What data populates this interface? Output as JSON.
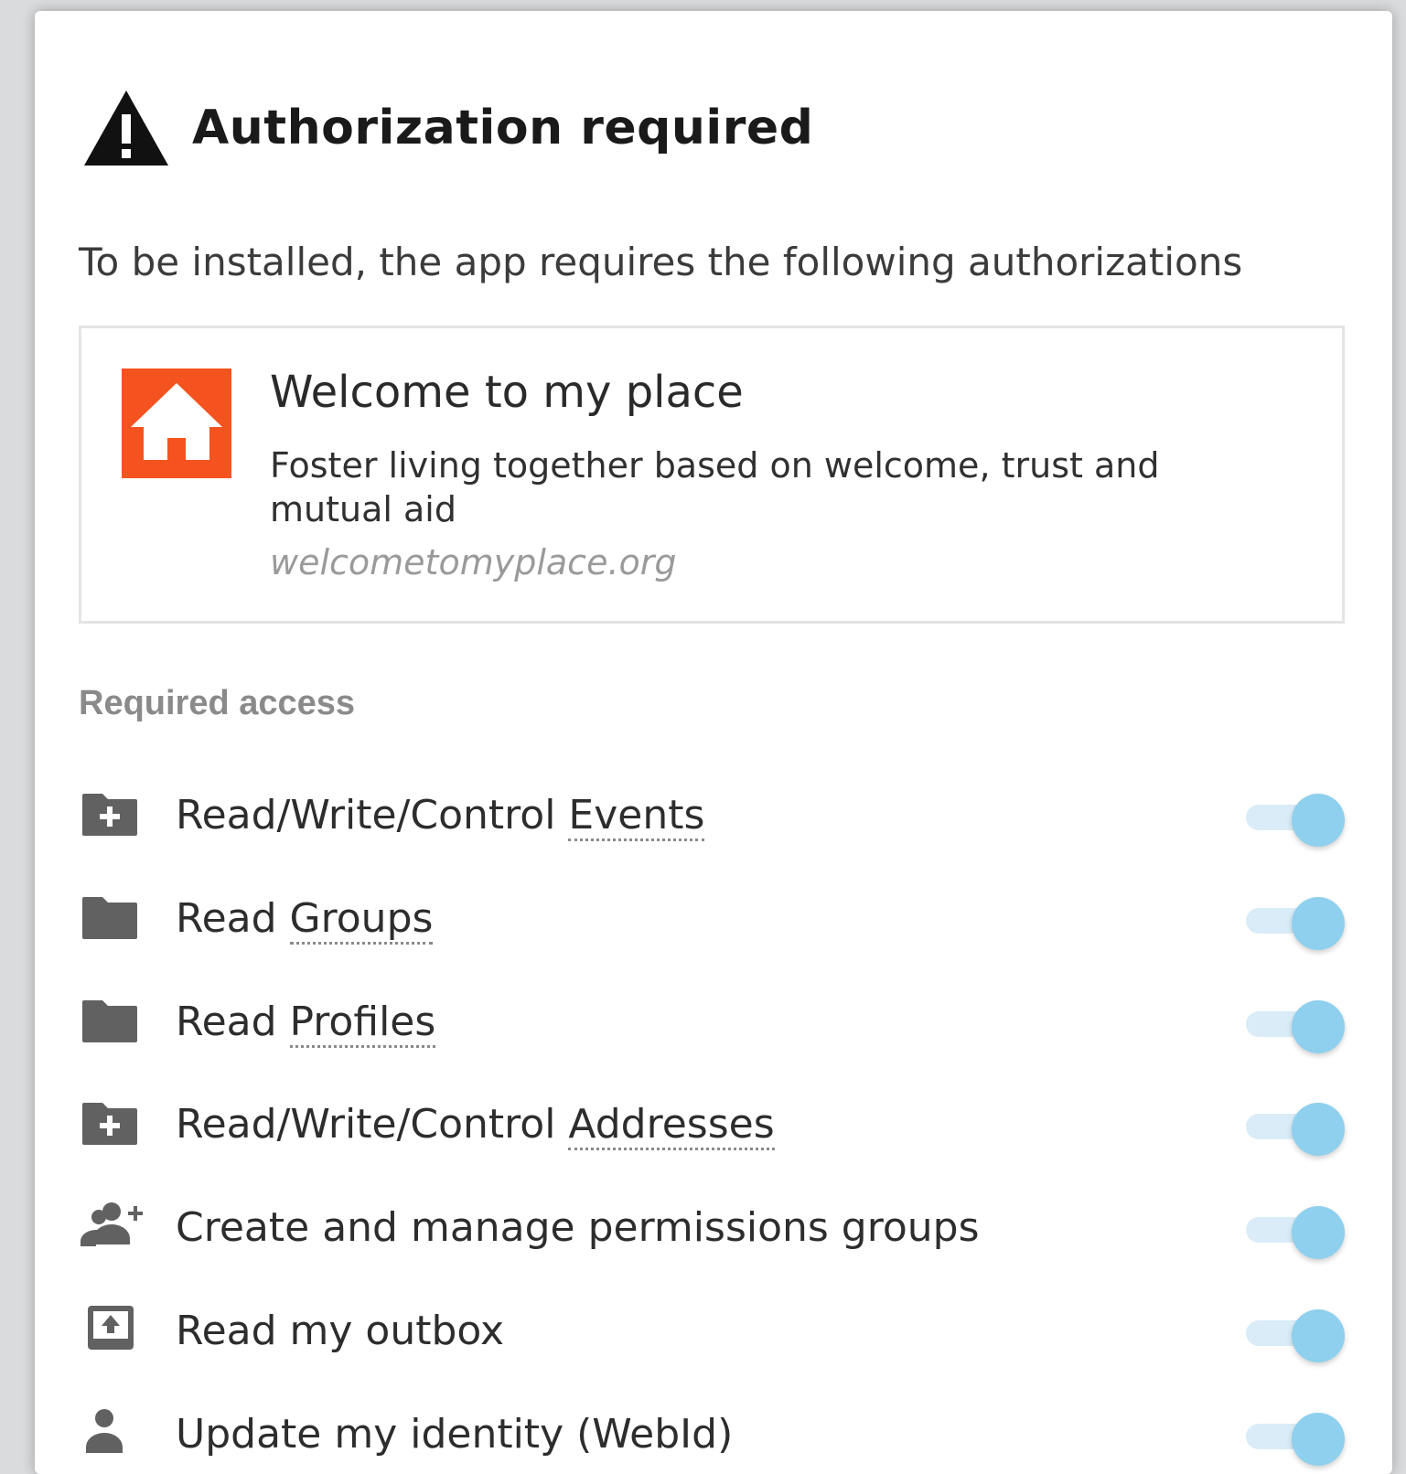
{
  "dialog": {
    "title": "Authorization required",
    "subtitle": "To be installed, the app requires the following authorizations"
  },
  "app": {
    "name": "Welcome to my place",
    "description": "Foster living together based on welcome, trust and mutual aid",
    "url": "welcometomyplace.org",
    "logo_icon": "house-icon",
    "logo_color": "#f4531f"
  },
  "section": {
    "label": "Required access"
  },
  "permissions": [
    {
      "prefix": "Read/Write/Control ",
      "resource": "Events",
      "icon": "folder-plus-icon",
      "enabled": true
    },
    {
      "prefix": "Read ",
      "resource": "Groups",
      "icon": "folder-icon",
      "enabled": true
    },
    {
      "prefix": "Read ",
      "resource": "Profiles",
      "icon": "folder-icon",
      "enabled": true
    },
    {
      "prefix": "Read/Write/Control ",
      "resource": "Addresses",
      "icon": "folder-plus-icon",
      "enabled": true
    },
    {
      "prefix": "Create and manage permissions groups",
      "resource": "",
      "icon": "add-users-icon",
      "enabled": true
    },
    {
      "prefix": "Read my outbox",
      "resource": "",
      "icon": "outbox-icon",
      "enabled": true
    },
    {
      "prefix": "Update my identity (WebId)",
      "resource": "",
      "icon": "person-icon",
      "enabled": true
    }
  ],
  "colors": {
    "toggle_track": "#d9ecf7",
    "toggle_knob": "#8ed0ee"
  }
}
